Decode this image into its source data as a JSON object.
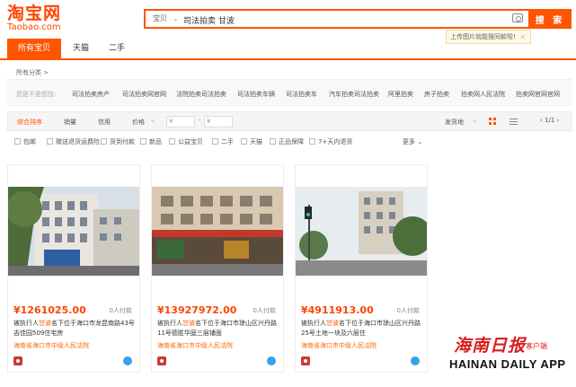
{
  "header": {
    "logo_cn": "淘宝网",
    "logo_en": "Taobao.com",
    "search_type": "宝贝",
    "search_value": "司法拍卖 甘波",
    "search_button": "搜 索",
    "tooltip": "上传图片就能搜同款啦!",
    "tooltip_close": "×"
  },
  "tabs": [
    {
      "label": "所有宝贝",
      "active": true
    },
    {
      "label": "天猫",
      "active": false
    },
    {
      "label": "二手",
      "active": false
    }
  ],
  "breadcrumb": "所有分类 >",
  "suggest": {
    "label": "您是不是想找:",
    "items": [
      "司法拍卖房产",
      "司法拍卖网官网",
      "法院拍卖司法拍卖",
      "司法拍卖车辆",
      "司法拍卖车",
      "汽车拍卖司法拍卖",
      "阿里拍卖",
      "房子拍卖",
      "拍卖网人民法院",
      "拍卖网官网官网"
    ]
  },
  "sort": {
    "items": [
      "综合排序",
      "销量",
      "信用",
      "价格"
    ],
    "price_from": "¥",
    "price_to": "¥",
    "ship_from": "发货地",
    "page": "1/1"
  },
  "filters": [
    "包邮",
    "赠送退货运费险",
    "货到付款",
    "新品",
    "公益宝贝",
    "二手",
    "天猫",
    "正品保障",
    "7+天内退货"
  ],
  "filters_more": "更多",
  "items": [
    {
      "price": "¥1261025.00",
      "paid": "0人付款",
      "title_pre": "被执行人",
      "title_hl": "甘波",
      "title_post": "名下位于海口市龙昆南路43号吉佳园509住宅房",
      "shop": "海南省海口市中级人民法院"
    },
    {
      "price": "¥13927972.00",
      "paid": "0人付款",
      "title_pre": "被执行人",
      "title_hl": "甘波",
      "title_post": "名下位于海口市琼山区兴丹路11号德胜华庭三层铺面",
      "shop": "海南省海口市中级人民法院"
    },
    {
      "price": "¥4911913.00",
      "paid": "0人付款",
      "title_pre": "被执行人",
      "title_hl": "甘波",
      "title_post": "名下位于海口市琼山区兴丹路25号土地一块及六层住",
      "shop": "海南省海口市中级人民法院"
    }
  ],
  "watermark": {
    "cn": "海南日报",
    "cn_small": "客户端",
    "en": "HAINAN DAILY APP"
  },
  "colors": {
    "accent": "#ff5500",
    "price": "#ff4400",
    "shop": "#ff6a00"
  }
}
